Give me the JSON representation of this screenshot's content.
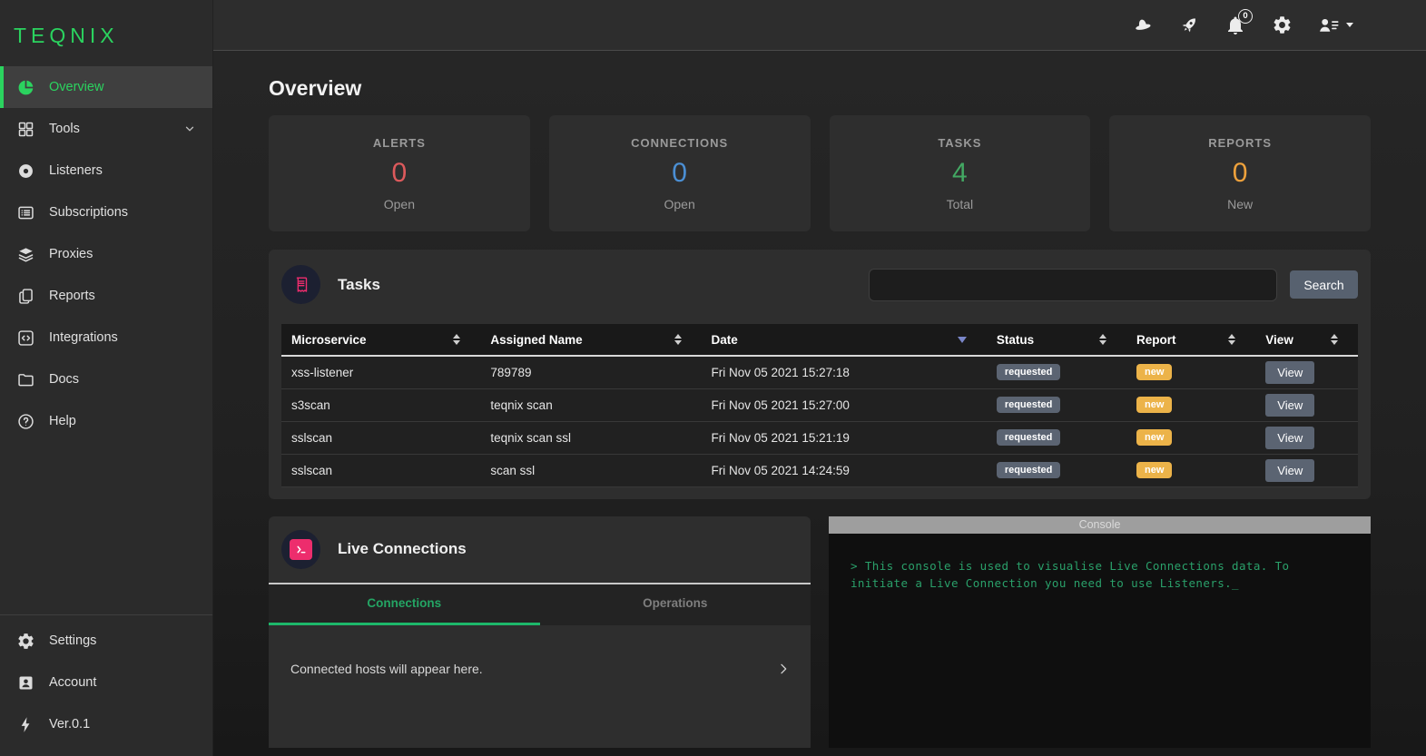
{
  "brand": {
    "logo": "TEQNIX",
    "accent_color": "#2bd35f"
  },
  "topbar": {
    "icons": [
      "hat-icon",
      "rocket-icon",
      "notifications-bell-icon",
      "gear-icon",
      "user-menu-icon"
    ],
    "notification_count": "0"
  },
  "sidebar": {
    "items": [
      {
        "icon": "pie-chart",
        "label": "Overview",
        "active": true
      },
      {
        "icon": "grid",
        "label": "Tools",
        "expandable": true
      },
      {
        "icon": "record-dot",
        "label": "Listeners"
      },
      {
        "icon": "list-box",
        "label": "Subscriptions"
      },
      {
        "icon": "layers",
        "label": "Proxies"
      },
      {
        "icon": "pages",
        "label": "Reports"
      },
      {
        "icon": "code-brackets",
        "label": "Integrations"
      },
      {
        "icon": "folder",
        "label": "Docs"
      },
      {
        "icon": "question-circle",
        "label": "Help"
      }
    ],
    "footer_items": [
      {
        "icon": "gear",
        "label": "Settings"
      },
      {
        "icon": "person-card",
        "label": "Account"
      },
      {
        "icon": "lightning-bolt",
        "label": "Ver.0.1"
      }
    ]
  },
  "page": {
    "title": "Overview"
  },
  "stats": [
    {
      "label": "ALERTS",
      "value": "0",
      "sub": "Open",
      "color": "#dd5a5c"
    },
    {
      "label": "CONNECTIONS",
      "value": "0",
      "sub": "Open",
      "color": "#4b8fd4"
    },
    {
      "label": "TASKS",
      "value": "4",
      "sub": "Total",
      "color": "#43a863"
    },
    {
      "label": "REPORTS",
      "value": "0",
      "sub": "New",
      "color": "#eda13c"
    }
  ],
  "tasks": {
    "title": "Tasks",
    "search": {
      "value": "",
      "button_label": "Search"
    },
    "table": {
      "columns": [
        "Microservice",
        "Assigned Name",
        "Date",
        "Status",
        "Report",
        "View"
      ],
      "sorted_column": "Date",
      "sort_direction": "desc",
      "rows": [
        {
          "microservice": "xss-listener",
          "assigned_name": "789789",
          "date": "Fri Nov 05 2021 15:27:18",
          "status": "requested",
          "report": "new",
          "view_label": "View"
        },
        {
          "microservice": "s3scan",
          "assigned_name": "teqnix scan",
          "date": "Fri Nov 05 2021 15:27:00",
          "status": "requested",
          "report": "new",
          "view_label": "View"
        },
        {
          "microservice": "sslscan",
          "assigned_name": "teqnix scan ssl",
          "date": "Fri Nov 05 2021 15:21:19",
          "status": "requested",
          "report": "new",
          "view_label": "View"
        },
        {
          "microservice": "sslscan",
          "assigned_name": "scan ssl",
          "date": "Fri Nov 05 2021 14:24:59",
          "status": "requested",
          "report": "new",
          "view_label": "View"
        }
      ],
      "status_badge_color": "#5b6472",
      "report_badge_color": "#ecb349"
    }
  },
  "live_connections": {
    "title": "Live Connections",
    "tabs": [
      {
        "label": "Connections",
        "active": true
      },
      {
        "label": "Operations",
        "active": false
      }
    ],
    "empty_message": "Connected hosts will appear here."
  },
  "console": {
    "title": "Console",
    "text": "> This console is used to visualise Live Connections data. To initiate a Live Connection you need to use Listeners._",
    "text_color": "#2aa06a"
  }
}
